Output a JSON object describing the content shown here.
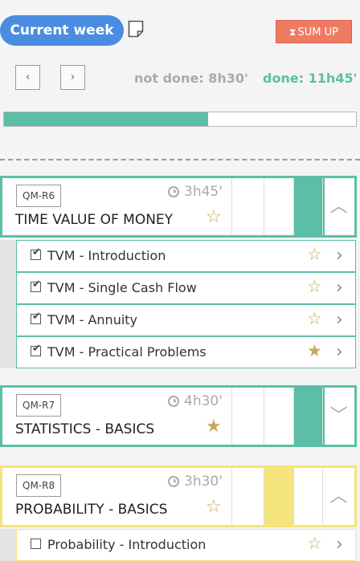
{
  "header": {
    "week_label": "Current week",
    "sumup_label": "SUM UP",
    "prev_label": "‹",
    "next_label": "›",
    "not_done_text": "not done: 8h30'",
    "done_text": "done: 11h45'",
    "progress_fraction": 0.58
  },
  "modules": [
    {
      "code": "QM-R6",
      "title": "TIME VALUE OF MONEY",
      "duration": "3h45'",
      "starred": false,
      "expanded": true,
      "chevron": "︿",
      "items": [
        {
          "label": "TVM - Introduction",
          "checked": true,
          "starred": false
        },
        {
          "label": "TVM - Single Cash Flow",
          "checked": true,
          "starred": false
        },
        {
          "label": "TVM - Annuity",
          "checked": true,
          "starred": false
        },
        {
          "label": "TVM - Practical Problems",
          "checked": true,
          "starred": true
        }
      ]
    },
    {
      "code": "QM-R7",
      "title": "STATISTICS - BASICS",
      "duration": "4h30'",
      "starred": true,
      "expanded": false,
      "chevron": "﹀",
      "items": []
    },
    {
      "code": "QM-R8",
      "title": "PROBABILITY - BASICS",
      "duration": "3h30'",
      "starred": false,
      "expanded": true,
      "chevron": "︿",
      "items": [
        {
          "label": "Probability - Introduction",
          "checked": false,
          "starred": false
        }
      ]
    }
  ],
  "colors": {
    "teal": "#5bbfa8",
    "yellow": "#f5e47c",
    "blue": "#4a8de0",
    "orange": "#ef7a63"
  }
}
